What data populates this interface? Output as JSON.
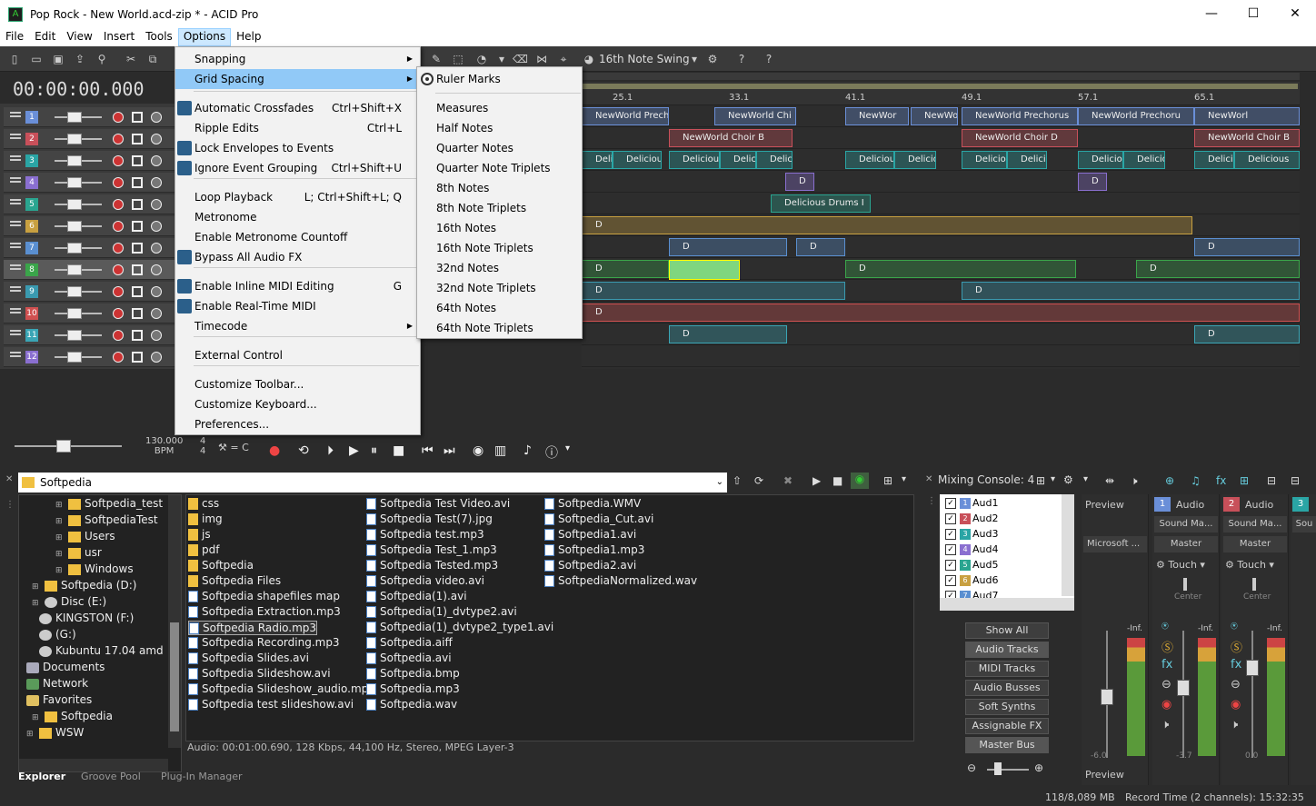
{
  "window": {
    "title": "Pop Rock - New World.acd-zip * - ACID Pro",
    "minimize": "—",
    "maximize": "☐",
    "close": "✕"
  },
  "menubar": [
    "File",
    "Edit",
    "View",
    "Insert",
    "Tools",
    "Options",
    "Help"
  ],
  "toolbar": {
    "swing_label": "16th Note Swing"
  },
  "timecode": "00:00:00.000",
  "ruler_labels": [
    "25.1",
    "33.1",
    "41.1",
    "49.1",
    "57.1",
    "65.1"
  ],
  "tracks": [
    {
      "num": "1",
      "color": "#6a8fd8"
    },
    {
      "num": "2",
      "color": "#c8505a"
    },
    {
      "num": "3",
      "color": "#2aa5a5"
    },
    {
      "num": "4",
      "color": "#8a6fd0"
    },
    {
      "num": "5",
      "color": "#2aa590"
    },
    {
      "num": "6",
      "color": "#c8a040"
    },
    {
      "num": "7",
      "color": "#5a8fd0"
    },
    {
      "num": "8",
      "color": "#3aa54a"
    },
    {
      "num": "9",
      "color": "#3a9ab0"
    },
    {
      "num": "10",
      "color": "#d05050"
    },
    {
      "num": "11",
      "color": "#3aa5b5"
    },
    {
      "num": "12",
      "color": "#8a6fd0"
    }
  ],
  "clips": {
    "prechorus": "NewWorld Prechoru",
    "prechorus2": "NewWorld Chi",
    "prechorus3": "NewWor",
    "prechorus4": "NewWorld",
    "prechorus5": "NewWorld Prechorus",
    "prechorus6": "NewWorld Prechoru",
    "prechorus7": "NewWorl",
    "choir1": "NewWorld Choir B",
    "choir2": "NewWorld Choir D",
    "choir3": "NewWorld Choir B",
    "delicious": "Delicious",
    "drums": "Delicious Drums I",
    "d": "D",
    "de": "De"
  },
  "bpm": {
    "value": "130.000",
    "label": "BPM",
    "sig_top": "4",
    "sig_bottom": "4",
    "key": "= C"
  },
  "options_menu": [
    {
      "label": "Snapping",
      "submenu": true
    },
    {
      "label": "Grid Spacing",
      "submenu": true
    },
    {
      "label": "Automatic Crossfades",
      "shortcut": "Ctrl+Shift+X"
    },
    {
      "label": "Ripple Edits",
      "shortcut": "Ctrl+L"
    },
    {
      "label": "Lock Envelopes to Events"
    },
    {
      "label": "Ignore Event Grouping",
      "shortcut": "Ctrl+Shift+U"
    },
    {
      "label": "Loop Playback",
      "shortcut": "L; Ctrl+Shift+L; Q"
    },
    {
      "label": "Metronome"
    },
    {
      "label": "Enable Metronome Countoff"
    },
    {
      "label": "Bypass All Audio FX"
    },
    {
      "label": "Enable Inline MIDI Editing",
      "shortcut": "G"
    },
    {
      "label": "Enable Real-Time MIDI"
    },
    {
      "label": "Timecode",
      "submenu": true
    },
    {
      "label": "External Control"
    },
    {
      "label": "Customize Toolbar..."
    },
    {
      "label": "Customize Keyboard..."
    },
    {
      "label": "Preferences..."
    }
  ],
  "grid_menu": [
    "Ruler Marks",
    "Measures",
    "Half Notes",
    "Quarter Notes",
    "Quarter Note Triplets",
    "8th Notes",
    "8th Note Triplets",
    "16th Notes",
    "16th Note Triplets",
    "32nd Notes",
    "32nd Note Triplets",
    "64th Notes",
    "64th Note Triplets"
  ],
  "explorer": {
    "path": "Softpedia",
    "tree": [
      "Softpedia_test",
      "SoftpediaTest",
      "Users",
      "usr",
      "Windows",
      "Softpedia (D:)",
      "Disc (E:)",
      "KINGSTON (F:)",
      "(G:)",
      "Kubuntu 17.04 amd",
      "Documents",
      "Network",
      "Favorites",
      "Softpedia",
      "WSW"
    ],
    "col1": [
      "css",
      "img",
      "js",
      "pdf",
      "Softpedia",
      "Softpedia Files",
      "Softpedia shapefiles map",
      "Softpedia Extraction.mp3",
      "Softpedia Radio.mp3",
      "Softpedia Recording.mp3",
      "Softpedia Slides.avi",
      "Softpedia Slideshow.avi",
      "Softpedia Slideshow_audio.mp3",
      "Softpedia test slideshow.avi"
    ],
    "col2": [
      "Softpedia Test Video.avi",
      "Softpedia Test(7).jpg",
      "Softpedia test.mp3",
      "Softpedia Test_1.mp3",
      "Softpedia Tested.mp3",
      "Softpedia video.avi",
      "Softpedia(1).avi",
      "Softpedia(1)_dvtype2.avi",
      "Softpedia(1)_dvtype2_type1.avi",
      "Softpedia.aiff",
      "Softpedia.avi",
      "Softpedia.bmp",
      "Softpedia.mp3",
      "Softpedia.wav"
    ],
    "col3": [
      "Softpedia.WMV",
      "Softpedia_Cut.avi",
      "Softpedia1.avi",
      "Softpedia1.mp3",
      "Softpedia2.avi",
      "SoftpediaNormalized.wav"
    ],
    "status": "Audio: 00:01:00.690, 128 Kbps, 44,100 Hz, Stereo, MPEG Layer-3",
    "tabs": [
      "Explorer",
      "Groove Pool",
      "Plug-In Manager"
    ]
  },
  "mixer": {
    "title": "Mixing Console: 4",
    "tracks": [
      "Aud1",
      "Aud2",
      "Aud3",
      "Aud4",
      "Aud5",
      "Aud6",
      "Aud7"
    ],
    "views": [
      "Show All",
      "Audio Tracks",
      "MIDI Tracks",
      "Audio Busses",
      "Soft Synths",
      "Assignable FX",
      "Master Bus"
    ],
    "preview": "Preview",
    "preview_device": "Microsoft ...",
    "strip1": {
      "num": "1",
      "name": "Audio",
      "device": "Sound Ma...",
      "bus": "Master",
      "mode": "Touch",
      "pan": "Center",
      "peak": "-Inf.",
      "level": "-3.7"
    },
    "strip2": {
      "num": "2",
      "name": "Audio",
      "device": "Sound Ma...",
      "bus": "Master",
      "mode": "Touch",
      "pan": "Center",
      "peak": "-Inf.",
      "level": "0.0"
    },
    "strip3": {
      "num": "3",
      "device": "Sou"
    },
    "preview_peak": "-Inf.",
    "preview_level": "-6.0"
  },
  "statusbar": {
    "memory": "118/8,089 MB",
    "record_time": "Record Time (2 channels): 15:32:35"
  }
}
